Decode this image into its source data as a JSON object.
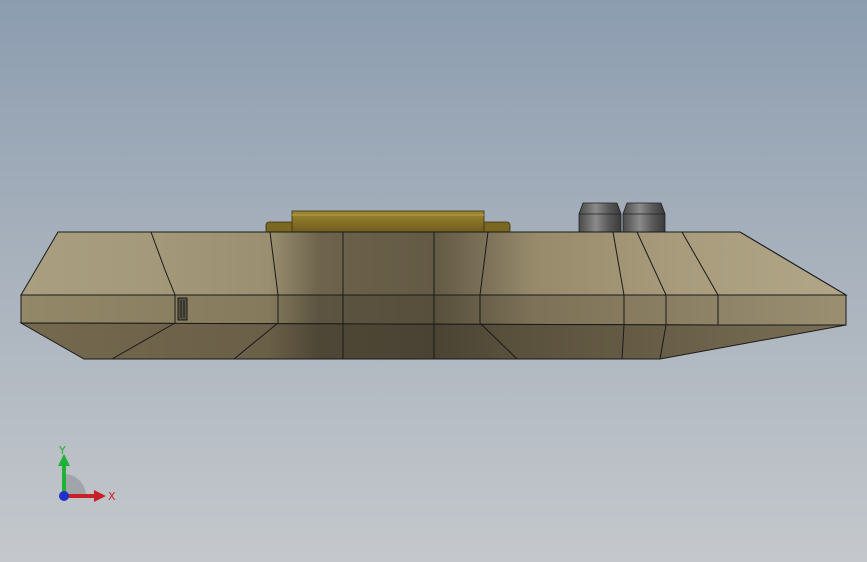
{
  "viewport": {
    "background_top": "#8c9db0",
    "background_bottom": "#c4c8cc"
  },
  "model": {
    "body_color": "#b0a484",
    "plate_color": "#8a7526",
    "knob_color": "#6e6e6e"
  },
  "triad": {
    "y_label": "Y",
    "x_label": "X",
    "y_color": "#1db233",
    "x_color": "#c8202a",
    "z_color": "#2030c8"
  }
}
